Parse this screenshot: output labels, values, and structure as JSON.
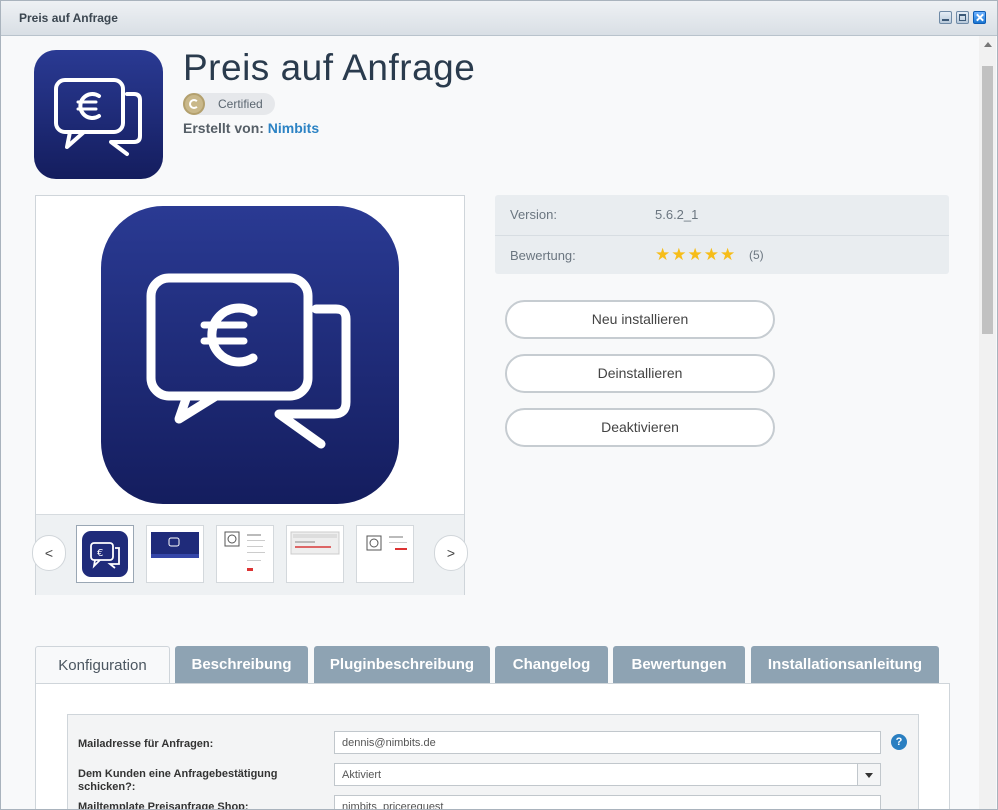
{
  "window": {
    "title": "Preis auf Anfrage"
  },
  "app": {
    "name": "Preis auf Anfrage",
    "certified_label": "Certified",
    "creator_prefix": "Erstellt von:",
    "creator_name": "Nimbits"
  },
  "gallery": {
    "prev_label": "<",
    "next_label": ">"
  },
  "info": {
    "version_label": "Version:",
    "version_value": "5.6.2_1",
    "rating_label": "Bewertung:",
    "rating_stars": 5,
    "rating_count": "(5)"
  },
  "actions": {
    "reinstall_label": "Neu installieren",
    "uninstall_label": "Deinstallieren",
    "deactivate_label": "Deaktivieren"
  },
  "tabs": [
    {
      "label": "Konfiguration",
      "active": true
    },
    {
      "label": "Beschreibung"
    },
    {
      "label": "Pluginbeschreibung"
    },
    {
      "label": "Changelog"
    },
    {
      "label": "Bewertungen"
    },
    {
      "label": "Installationsanleitung"
    }
  ],
  "config": {
    "mail_label": "Mailadresse für Anfragen:",
    "mail_value": "dennis@nimbits.de",
    "confirm_label": "Dem Kunden eine Anfragebestätigung schicken?:",
    "confirm_value": "Aktiviert",
    "template_label": "Mailtemplate Preisanfrage Shop:",
    "template_value": "nimbits_pricerequest",
    "help_label": "?"
  },
  "colors": {
    "accent": "#2c83c4",
    "tab_bg": "#8ea3b3",
    "icon_bg": "#1f2b7a",
    "star": "#f6bd19"
  }
}
